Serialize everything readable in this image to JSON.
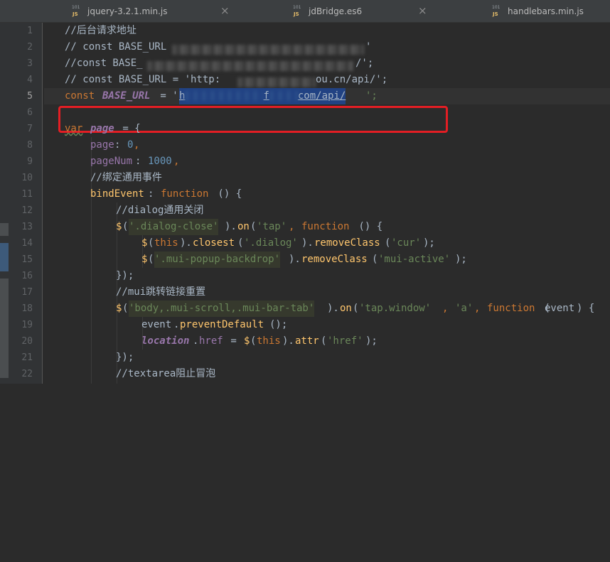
{
  "tabs": [
    {
      "name": "jquery-3.2.1.min.js",
      "icon": "js-file-icon"
    },
    {
      "name": "jdBridge.es6",
      "icon": "es6-file-icon"
    },
    {
      "name": "handlebars.min.js",
      "icon": "js-file-icon"
    }
  ],
  "line_numbers": [
    "1",
    "2",
    "3",
    "4",
    "5",
    "6",
    "7",
    "8",
    "9",
    "10",
    "11",
    "12",
    "13",
    "14",
    "15",
    "16",
    "17",
    "18",
    "19",
    "20",
    "21",
    "22"
  ],
  "code": {
    "l1": "//后台请求地址",
    "l2a": "// const BASE_URL",
    "l2b": "'",
    "l3a": "//const BASE_",
    "l3b": "/';",
    "l4a": "// const BASE_URL = 'http:",
    "l4b": "ou.cn/api/';",
    "l5_const": "const",
    "l5_var": "BASE_URL",
    "l5_eq": " = '",
    "l5_url_a": "h",
    "l5_url_b": "f",
    "l5_url_c": "com/api/",
    "l5_end": "';",
    "l7_var": "var",
    "l7_name": "page",
    "l7_rest": " = {",
    "l8_prop": "page",
    "l8_val": "0",
    "l9_prop": "pageNum",
    "l9_val": "1000",
    "l10": "//绑定通用事件",
    "l11_prop": "bindEvent",
    "l11_fn": "function",
    "l11_rest": " () {",
    "l12": "//dialog通用关闭",
    "l13_sel": "'.dialog-close'",
    "l13_on": "on",
    "l13_evt": "'tap'",
    "l13_fn": "function",
    "l14_this": "this",
    "l14_closest": "closest",
    "l14_dialog": "'.dialog'",
    "l14_remove": "removeClass",
    "l14_cur": "'cur'",
    "l15_sel": "'.mui-popup-backdrop'",
    "l15_remove": "removeClass",
    "l15_cls": "'mui-active'",
    "l16": "});",
    "l17": "//mui跳转链接重置",
    "l18_sel": "'body,.mui-scroll,.mui-bar-tab'",
    "l18_on": "on",
    "l18_evt": "'tap.window'",
    "l18_a": "'a'",
    "l18_fn": "function",
    "l18_param": "event",
    "l19_obj": "event",
    "l19_m": "preventDefault",
    "l20_loc": "location",
    "l20_href": "href",
    "l20_this": "this",
    "l20_attr": "attr",
    "l20_arg": "'href'",
    "l21": "});",
    "l22": "//textarea阻止冒泡"
  },
  "colors": {
    "keyword": "#cc7832",
    "string": "#6a8759",
    "function": "#ffc66d",
    "number": "#6897bb",
    "property": "#9876aa",
    "highlight_box": "#e31e24"
  }
}
